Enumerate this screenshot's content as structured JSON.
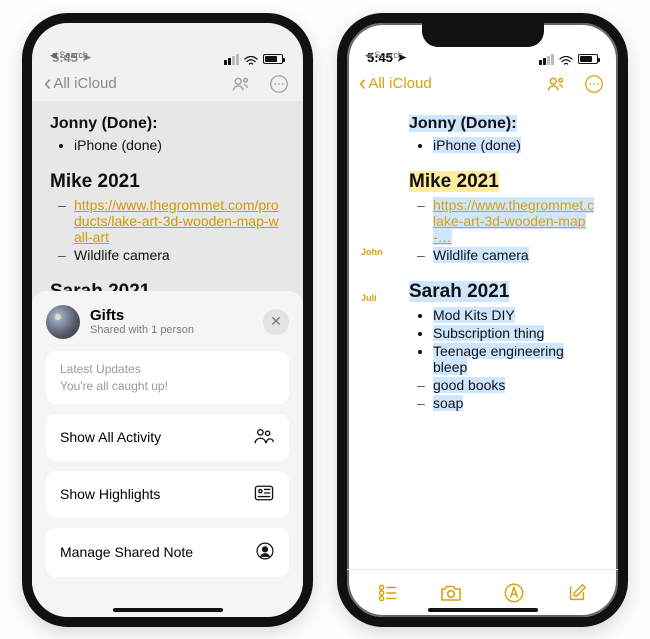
{
  "status": {
    "time": "5:45",
    "back_to": "Search"
  },
  "nav": {
    "back_label": "All iCloud"
  },
  "note": {
    "section1_title": "Jonny (Done):",
    "section1_items": [
      "iPhone (done)"
    ],
    "section2_title": "Mike 2021",
    "section2_link": "https://www.thegrommet.com/products/lake-art-3d-wooden-map-wall-art",
    "section2_link_trunc": "https://www.thegrommet.c\nlake-art-3d-wooden-map-…",
    "section2_item2": "Wildlife camera",
    "section3_title": "Sarah 2021",
    "section3_item1_trunc": "Mod Kits DIY",
    "section3_items": [
      "Mod Kits DIY",
      "Subscription thing",
      "Teenage engineering bleep"
    ],
    "section3_dash": [
      "good books",
      "soap"
    ]
  },
  "authors": {
    "a1": "John",
    "a2": "Juli"
  },
  "sheet": {
    "title": "Gifts",
    "subtitle": "Shared with 1 person",
    "updates_label": "Latest Updates",
    "updates_msg": "You're all caught up!",
    "action1": "Show All Activity",
    "action2": "Show Highlights",
    "action3": "Manage Shared Note"
  }
}
